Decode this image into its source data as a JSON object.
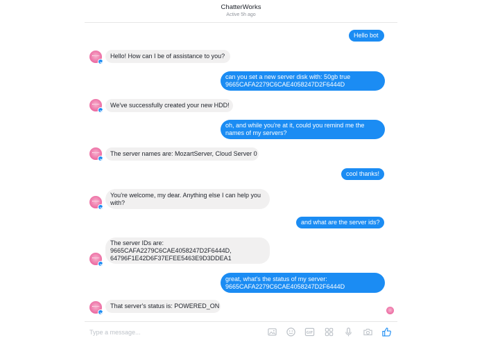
{
  "header": {
    "name": "ChatterWorks",
    "status": "Active 5h ago"
  },
  "messages": [
    {
      "from": "user",
      "lines": [
        "Hello bot"
      ]
    },
    {
      "from": "bot",
      "lines": [
        "Hello! How can I be of assistance to you?"
      ]
    },
    {
      "from": "user",
      "lines": [
        "can you set a new server disk with: 50gb true",
        "9665CAFA2279C6CAE4058247D2F6444D"
      ]
    },
    {
      "from": "bot",
      "lines": [
        "We've successfully created your new HDD!"
      ]
    },
    {
      "from": "user",
      "lines": [
        "oh, and while you're at it, could you remind me the",
        "names of my servers?"
      ]
    },
    {
      "from": "bot",
      "lines": [
        "The server names are: MozartServer, Cloud Server 0"
      ]
    },
    {
      "from": "user",
      "lines": [
        "cool thanks!"
      ]
    },
    {
      "from": "bot",
      "lines": [
        "You're welcome, my dear. Anything else I can help you",
        "with?"
      ]
    },
    {
      "from": "user",
      "lines": [
        "and what are the server ids?"
      ]
    },
    {
      "from": "bot",
      "lines": [
        "The server IDs are:",
        "9665CAFA2279C6CAE4058247D2F6444D,",
        "64796F1E42D6F37EFEE5463E9D3DDEA1"
      ]
    },
    {
      "from": "user",
      "lines": [
        "great, what's the status of my server:",
        "9665CAFA2279C6CAE4058247D2F6444D"
      ]
    },
    {
      "from": "bot",
      "lines": [
        "That server's status is: POWERED_ON"
      ]
    }
  ],
  "composer": {
    "placeholder": "Type a message...",
    "icons": [
      "image-icon",
      "emoji-icon",
      "gif-icon",
      "sticker-icon",
      "microphone-icon",
      "camera-icon",
      "like-icon"
    ]
  },
  "colors": {
    "user_bubble": "#1b8cf3",
    "bot_bubble": "#f1f0f0",
    "accent": "#1b8cf3"
  }
}
